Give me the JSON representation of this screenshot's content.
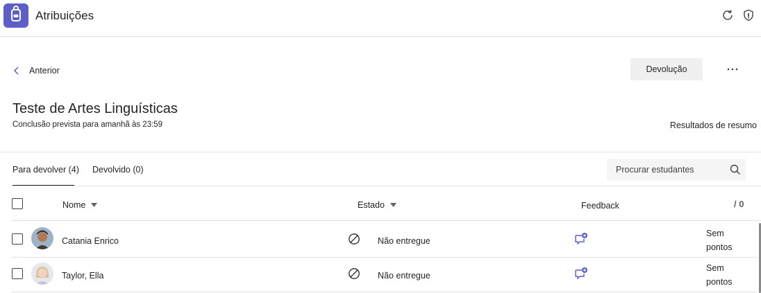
{
  "app": {
    "title": "Atribuições",
    "icon": "backpack-icon",
    "accent_color": "#5b5fc7"
  },
  "toolbar": {
    "refresh_icon": "refresh-icon",
    "shield_icon": "shield-icon"
  },
  "nav": {
    "back_label": "Anterior",
    "return_button_label": "Devolução",
    "more_icon": "more-horizontal-icon"
  },
  "assignment": {
    "title": "Teste de Artes Linguísticas",
    "due": "Conclusão prevista para amanhã às 23:59",
    "summary_link": "Resultados de resumo"
  },
  "tabs": [
    {
      "label": "Para devolver (4)",
      "active": true
    },
    {
      "label": "Devolvido (0)",
      "active": false
    }
  ],
  "search": {
    "placeholder": "Procurar estudantes",
    "value": ""
  },
  "table": {
    "columns": {
      "name": "Nome",
      "status": "Estado",
      "feedback": "Feedback",
      "points": "/ 0"
    },
    "rows": [
      {
        "name": "Catania Enrico",
        "status": "Não entregue",
        "points": "Sem pontos",
        "avatar": "avatar-catania"
      },
      {
        "name": "Taylor, Ella",
        "status": "Não entregue",
        "points": "Sem pontos",
        "avatar": "avatar-taylor"
      }
    ]
  }
}
